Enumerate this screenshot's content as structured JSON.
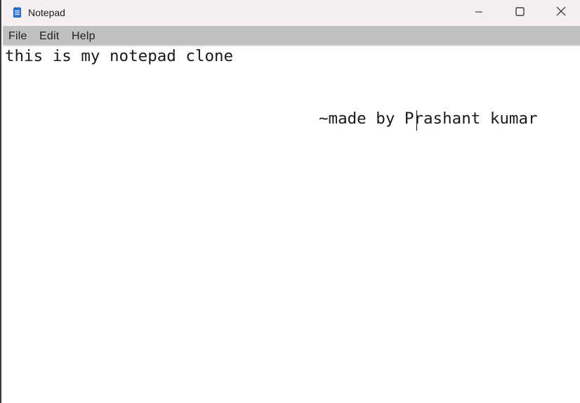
{
  "window": {
    "title": "Notepad",
    "app_icon": "notepad-icon",
    "controls": {
      "minimize_icon": "minimize-icon",
      "maximize_icon": "maximize-icon",
      "close_icon": "close-icon"
    }
  },
  "menubar": {
    "items": [
      {
        "label": "File"
      },
      {
        "label": "Edit"
      },
      {
        "label": "Help"
      }
    ]
  },
  "editor": {
    "lines": [
      "this is my notepad clone",
      "~made by Prashant kumar"
    ]
  },
  "colors": {
    "titlebar_bg": "#f6eff1",
    "menubar_bg": "#c0c0c0",
    "editor_bg": "#ffffff",
    "text": "#1a1a1a"
  }
}
